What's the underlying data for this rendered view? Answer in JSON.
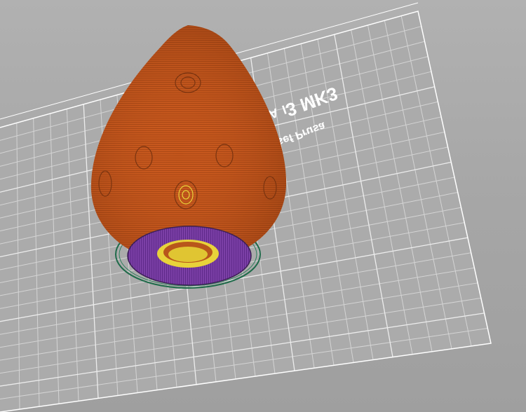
{
  "viewer": {
    "bed_logo_line1": "Original Prusa i3 MK3",
    "bed_logo_line2": "by Josef Prusa",
    "colors": {
      "background": "#a7a7a7",
      "bed_grid": "#d4d4d4",
      "bed_border": "#ffffff",
      "model_perimeter": "#c8581d",
      "model_ring_dark": "#7a3410",
      "infill_solid": "#7b3fa6",
      "top_infill": "#e8d23a",
      "skirt": "#1f6b4a"
    },
    "icons": [
      "print-bed-icon",
      "gcode-toolpath-icon"
    ]
  }
}
